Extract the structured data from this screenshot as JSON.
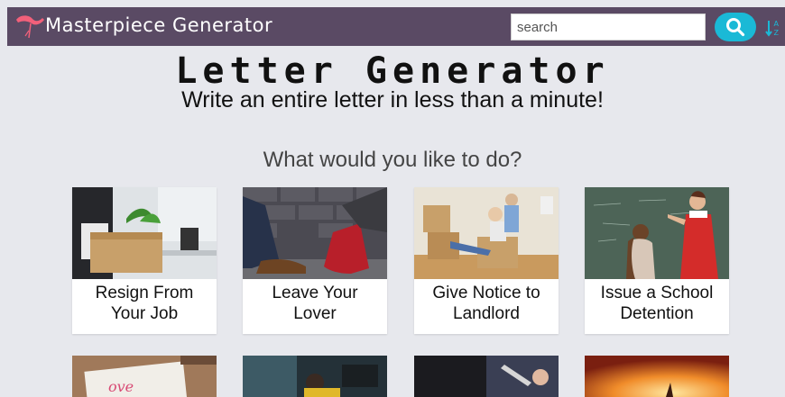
{
  "header": {
    "brand": "Masterpiece Generator",
    "search_placeholder": "search",
    "search_button_icon": "search-icon",
    "sort_icon": "sort-az-icon"
  },
  "hero": {
    "title": "Letter Generator",
    "subtitle": "Write an entire letter in less than a minute!"
  },
  "prompt": "What would you like to do?",
  "cards": [
    {
      "line1": "Resign From",
      "line2": "Your Job"
    },
    {
      "line1": "Leave Your",
      "line2": "Lover"
    },
    {
      "line1": "Give Notice to",
      "line2": "Landlord"
    },
    {
      "line1": "Issue a School",
      "line2": "Detention"
    }
  ],
  "colors": {
    "header_bg": "#5a4a64",
    "accent": "#1ab9d6",
    "page_bg": "#e7e8ed"
  }
}
